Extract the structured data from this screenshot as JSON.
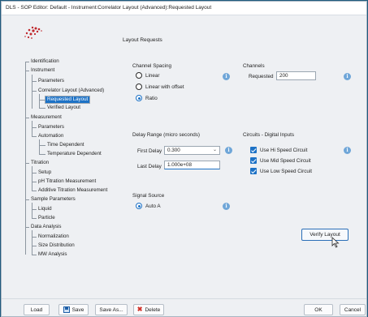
{
  "window": {
    "title": "DLS - SOP Editor: Default - Instrument:Correlator Layout (Advanced):Requested Layout"
  },
  "header": {
    "label": "Layout Requests"
  },
  "tree": {
    "items": [
      {
        "label": "Identification"
      },
      {
        "label": "Instrument"
      },
      {
        "label": "Parameters"
      },
      {
        "label": "Correlator Layout (Advanced)"
      },
      {
        "label": "Requested Layout",
        "selected": true
      },
      {
        "label": "Verified Layout"
      },
      {
        "label": "Measurement"
      },
      {
        "label": "Parameters"
      },
      {
        "label": "Automation"
      },
      {
        "label": "Time Dependent"
      },
      {
        "label": "Temperature Dependent"
      },
      {
        "label": "Titration"
      },
      {
        "label": "Setup"
      },
      {
        "label": "pH Titration Measurement"
      },
      {
        "label": "Additive Titration Measurement"
      },
      {
        "label": "Sample Parameters"
      },
      {
        "label": "Liquid"
      },
      {
        "label": "Particle"
      },
      {
        "label": "Data Analysis"
      },
      {
        "label": "Normalization"
      },
      {
        "label": "Size Distribution"
      },
      {
        "label": "MW Analysis"
      }
    ]
  },
  "channel_spacing": {
    "label": "Channel Spacing",
    "options": [
      {
        "label": "Linear",
        "selected": false
      },
      {
        "label": "Linear with offset",
        "selected": false
      },
      {
        "label": "Ratio",
        "selected": true
      }
    ]
  },
  "channels": {
    "label": "Channels",
    "requested_label": "Requested",
    "requested_value": "200"
  },
  "delay_range": {
    "label": "Delay Range (micro seconds)",
    "first_delay_label": "First Delay",
    "first_delay_value": "0.300",
    "last_delay_label": "Last Delay",
    "last_delay_value": "1.000e+08"
  },
  "circuits": {
    "label": "Circuits - Digital Inputs",
    "items": [
      {
        "label": "Use Hi Speed Circuit",
        "checked": true
      },
      {
        "label": "Use Mid Speed Circuit",
        "checked": true
      },
      {
        "label": "Use Low Speed Circuit",
        "checked": true
      }
    ]
  },
  "signal_source": {
    "label": "Signal Source",
    "option": "Auto A"
  },
  "buttons": {
    "verify_layout": "Verify Layout",
    "load": "Load",
    "save": "Save",
    "save_as": "Save As...",
    "delete": "Delete",
    "ok": "OK",
    "cancel": "Cancel"
  },
  "icons": {
    "info": "info-icon",
    "save": "floppy-disk-icon",
    "delete": "red-x-icon",
    "chevron": "chevron-down-icon"
  },
  "colors": {
    "accent": "#1d72c6",
    "info": "#6fa6d8",
    "logo_red": "#c0282d"
  }
}
